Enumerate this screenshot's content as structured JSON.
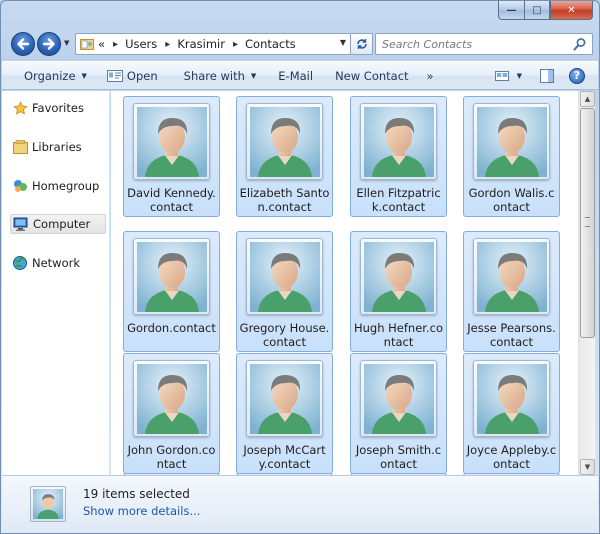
{
  "window": {
    "caption_buttons": {
      "minimize": "—",
      "maximize": "□",
      "close": "✕"
    }
  },
  "address_bar": {
    "overflow_chevron": "«",
    "breadcrumbs": [
      "Users",
      "Krasimir",
      "Contacts"
    ],
    "separator": "▸"
  },
  "search": {
    "placeholder": "Search Contacts"
  },
  "toolbar": {
    "items": [
      {
        "label": "Organize",
        "has_dropdown": true
      },
      {
        "label": "Open",
        "icon": "open-icon"
      },
      {
        "label": "Share with",
        "has_dropdown": true
      },
      {
        "label": "E-Mail"
      },
      {
        "label": "New Contact"
      },
      {
        "label": "»"
      }
    ],
    "right_icons": [
      "views-icon",
      "preview-pane-icon",
      "help-icon"
    ]
  },
  "navigation": {
    "items": [
      {
        "label": "Favorites",
        "icon": "star-icon"
      },
      {
        "label": "Libraries",
        "icon": "libraries-icon"
      },
      {
        "label": "Homegroup",
        "icon": "homegroup-icon"
      },
      {
        "label": "Computer",
        "icon": "computer-icon",
        "selected": true
      },
      {
        "label": "Network",
        "icon": "network-icon"
      }
    ]
  },
  "contacts": [
    {
      "name": "David Kennedy.contact"
    },
    {
      "name": "Elizabeth Santon.contact"
    },
    {
      "name": "Ellen Fitzpatrick.contact"
    },
    {
      "name": "Gordon Walis.contact"
    },
    {
      "name": "Gordon.contact"
    },
    {
      "name": "Gregory House.contact"
    },
    {
      "name": "Hugh Hefner.contact"
    },
    {
      "name": "Jesse Pearsons.contact"
    },
    {
      "name": "John Gordon.contact"
    },
    {
      "name": "Joseph McCarty.contact"
    },
    {
      "name": "Joseph Smith.contact"
    },
    {
      "name": "Joyce Appleby.contact"
    }
  ],
  "details": {
    "selection_count": "19 items selected",
    "show_more": "Show more details..."
  },
  "colors": {
    "selection_fill": "#cce4fc",
    "selection_border": "#84acdd",
    "link": "#1b57b1",
    "toolbar_text": "#1e395b"
  }
}
